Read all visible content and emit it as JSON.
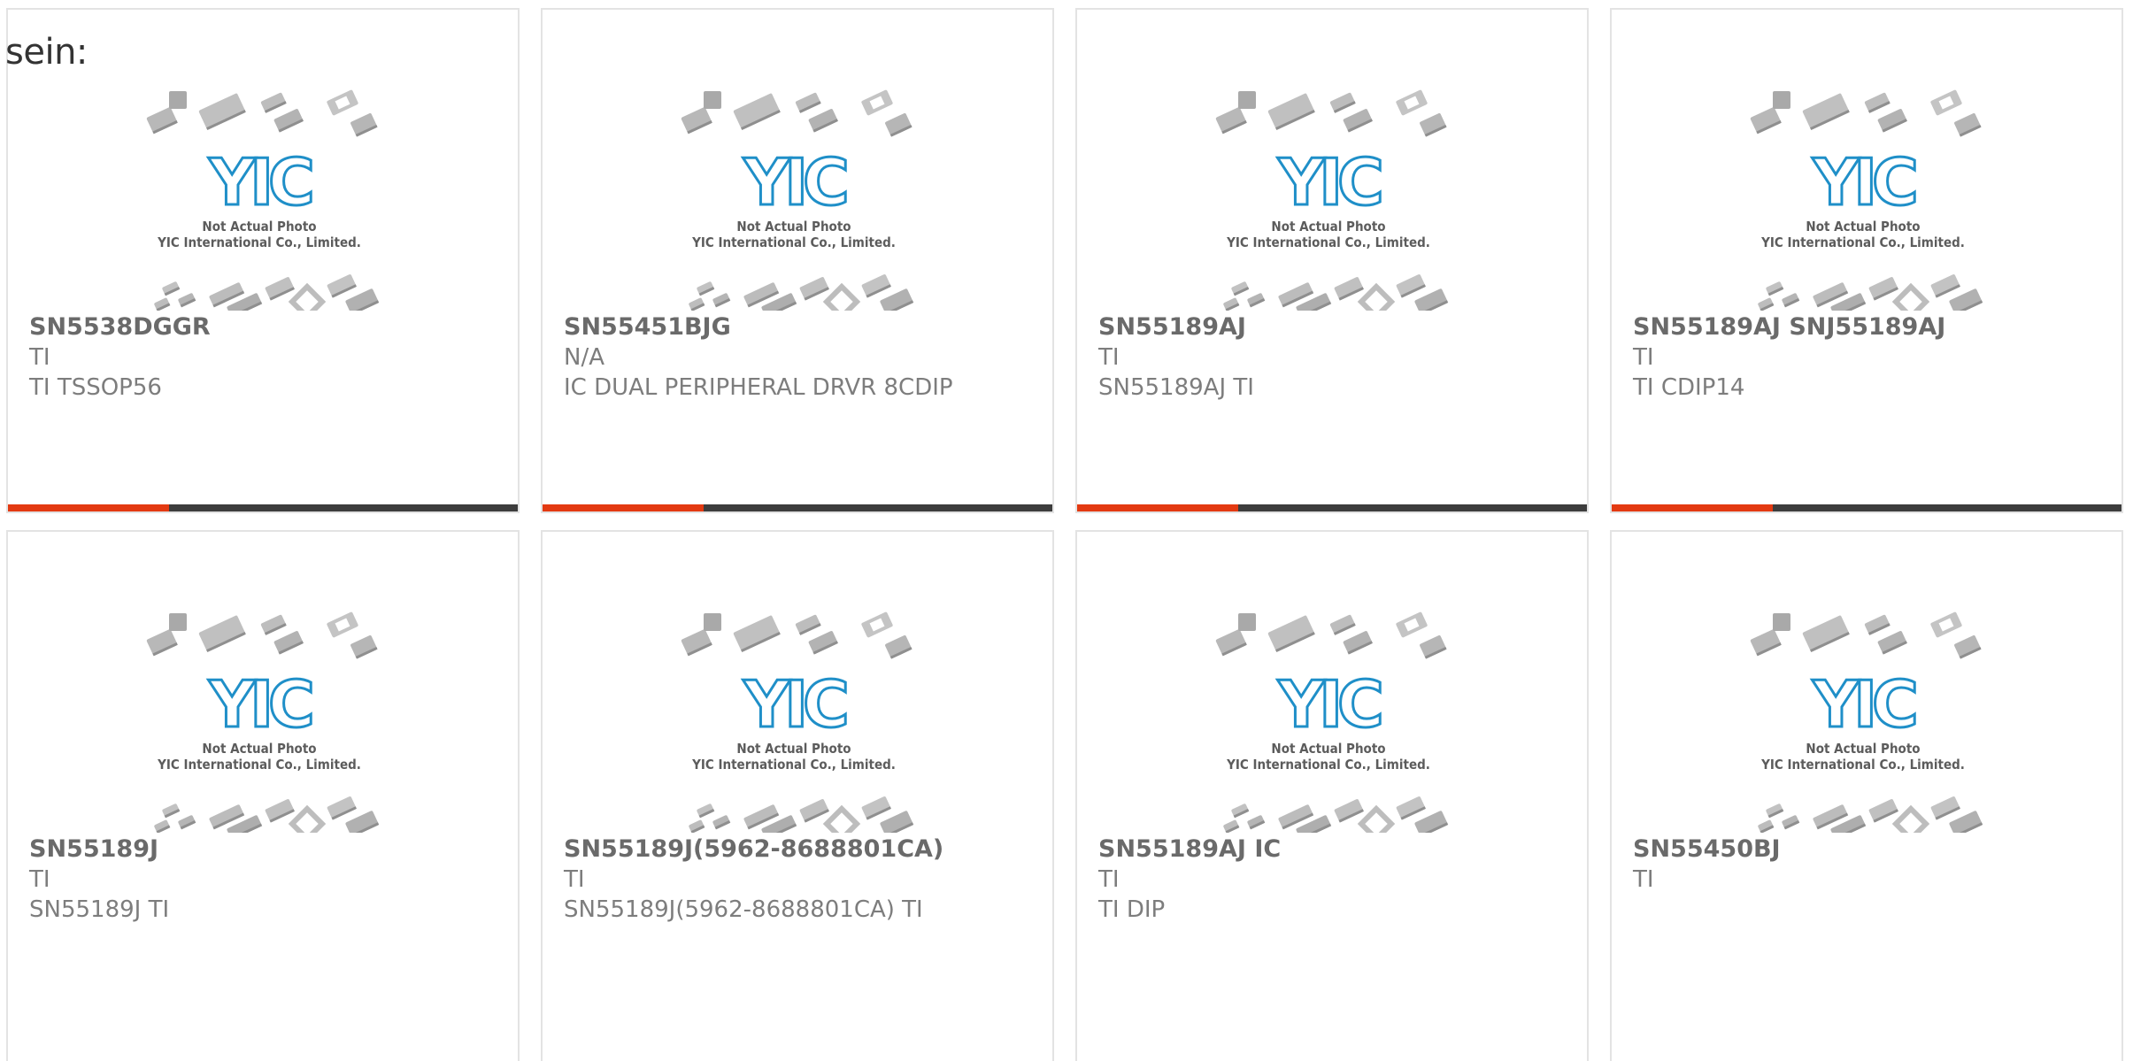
{
  "header": {
    "lead_text": "sein:"
  },
  "placeholder_image": {
    "line1": "Not Actual Photo",
    "line2": "YIC International Co., Limited.",
    "logo_text": "YIC",
    "logo_color": "#1f8fc8"
  },
  "colors": {
    "accent_bar": "#e33a12",
    "dark_bar": "#3d3d3d",
    "border": "#e3e3e3"
  },
  "products": [
    {
      "part": "SN5538DGGR",
      "maker": "TI",
      "desc": "TI TSSOP56"
    },
    {
      "part": "SN55451BJG",
      "maker": "N/A",
      "desc": "IC DUAL PERIPHERAL DRVR 8CDIP"
    },
    {
      "part": "SN55189AJ",
      "maker": "TI",
      "desc": "SN55189AJ TI"
    },
    {
      "part": "SN55189AJ SNJ55189AJ",
      "maker": "TI",
      "desc": "TI CDIP14"
    },
    {
      "part": "SN55189J",
      "maker": "TI",
      "desc": "SN55189J TI"
    },
    {
      "part": "SN55189J(5962-8688801CA)",
      "maker": "TI",
      "desc": "SN55189J(5962-8688801CA) TI"
    },
    {
      "part": "SN55189AJ IC",
      "maker": "TI",
      "desc": "TI DIP"
    },
    {
      "part": "SN55450BJ",
      "maker": "TI",
      "desc": ""
    }
  ]
}
